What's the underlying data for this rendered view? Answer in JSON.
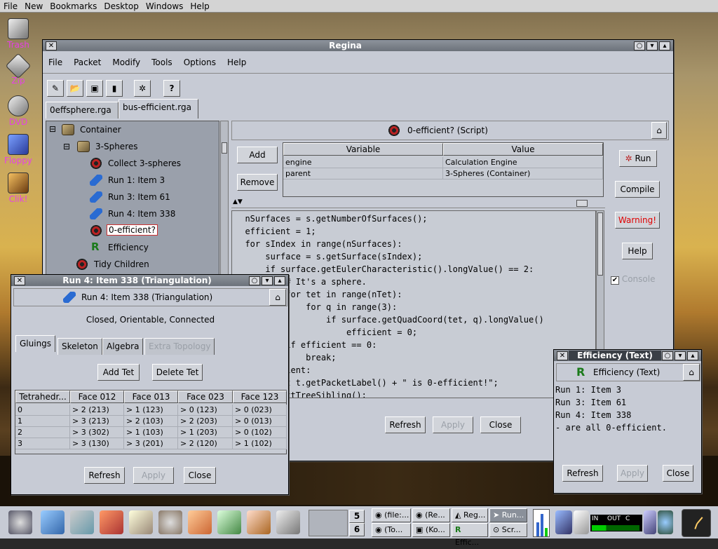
{
  "global_menu": [
    "File",
    "New",
    "Bookmarks",
    "Desktop",
    "Windows",
    "Help"
  ],
  "desktop_icons": [
    {
      "label": "Trash",
      "icon": "trash-icon"
    },
    {
      "label": "Zip",
      "icon": "zip-drive-icon"
    },
    {
      "label": "DVD",
      "icon": "dvd-icon"
    },
    {
      "label": "Floppy",
      "icon": "floppy-icon"
    },
    {
      "label": "Clik!",
      "icon": "clik-drive-icon"
    }
  ],
  "regina": {
    "title": "Regina",
    "menu": [
      "File",
      "Packet",
      "Modify",
      "Tools",
      "Options",
      "Help"
    ],
    "toolbar_help": "?",
    "tabs": [
      "0effsphere.rga",
      "bus-efficient.rga"
    ],
    "tree": [
      {
        "label": "Container",
        "icon": "container-icon"
      },
      {
        "label": "3-Spheres",
        "icon": "container-icon"
      },
      {
        "label": "Collect 3-spheres",
        "icon": "script-gear-icon"
      },
      {
        "label": "Run 1: Item 3",
        "icon": "triangulation-icon"
      },
      {
        "label": "Run 3: Item 61",
        "icon": "triangulation-icon"
      },
      {
        "label": "Run 4: Item 338",
        "icon": "triangulation-icon"
      },
      {
        "label": "0-efficient?",
        "icon": "script-gear-icon"
      },
      {
        "label": "Efficiency",
        "icon": "text-R-icon"
      },
      {
        "label": "Tidy Children",
        "icon": "script-gear-icon"
      }
    ],
    "script_header": "0-efficient? (Script)",
    "add": "Add",
    "remove": "Remove",
    "var_headers": [
      "Variable",
      "Value"
    ],
    "vars": [
      {
        "name": "engine",
        "value": "Calculation Engine"
      },
      {
        "name": "parent",
        "value": "3-Spheres (Container)"
      }
    ],
    "code": [
      "  nSurfaces = s.getNumberOfSurfaces();",
      "  efficient = 1;",
      "  for sIndex in range(nSurfaces):",
      "      surface = s.getSurface(sIndex);",
      "      if surface.getEulerCharacteristic().longValue() == 2:",
      "          # It's a sphere.",
      "          for tet in range(nTet):",
      "              for q in range(3):",
      "                  if surface.getQuadCoord(tet, q).longValue()",
      "                      efficient = 0;",
      "          if efficient == 0:",
      "              break;",
      "  if efficient:",
      "      print t.getPacketLabel() + \" is 0-efficient!\";",
      "  t = t.nextTreeSibling();"
    ],
    "run": "Run",
    "compile": "Compile",
    "warning": "Warning!",
    "help": "Help",
    "console": "Console",
    "refresh": "Refresh",
    "apply": "Apply",
    "close": "Close"
  },
  "tri_window": {
    "title": "Run 4: Item 338 (Triangulation)",
    "header": "Run 4: Item 338 (Triangulation)",
    "status": "Closed, Orientable, Connected",
    "tabs": [
      "Gluings",
      "Skeleton",
      "Algebra",
      "Extra Topology"
    ],
    "add_tet": "Add Tet",
    "delete_tet": "Delete Tet",
    "columns": [
      "Tetrahedr...",
      "Face 012",
      "Face 013",
      "Face 023",
      "Face 123"
    ],
    "rows": [
      [
        "0",
        "> 2 (213)",
        "> 1 (123)",
        "> 0 (123)",
        "> 0 (023)"
      ],
      [
        "1",
        "> 3 (213)",
        "> 2 (103)",
        "> 2 (203)",
        "> 0 (013)"
      ],
      [
        "2",
        "> 3 (302)",
        "> 1 (103)",
        "> 1 (203)",
        "> 0 (102)"
      ],
      [
        "3",
        "> 3 (130)",
        "> 3 (201)",
        "> 2 (120)",
        "> 1 (102)"
      ]
    ],
    "refresh": "Refresh",
    "apply": "Apply",
    "close": "Close"
  },
  "text_window": {
    "title": "Efficiency (Text)",
    "header": "Efficiency (Text)",
    "lines": [
      "Run 1: Item 3",
      "Run 3: Item 61",
      "Run 4: Item 338",
      "- are all 0-efficient."
    ],
    "refresh": "Refresh",
    "apply": "Apply",
    "close": "Close"
  },
  "taskbar": {
    "pager": [
      "5",
      "6"
    ],
    "tasks": [
      "(file:...",
      "(Re...",
      "Reg...",
      "Run...",
      "(To...",
      "(Ko...",
      "Effic...",
      "Scr..."
    ],
    "net": [
      "IN",
      "OUT",
      "C"
    ]
  },
  "colors": {
    "accent_warning": "#e00000",
    "desktop_label": "#e640e6"
  }
}
